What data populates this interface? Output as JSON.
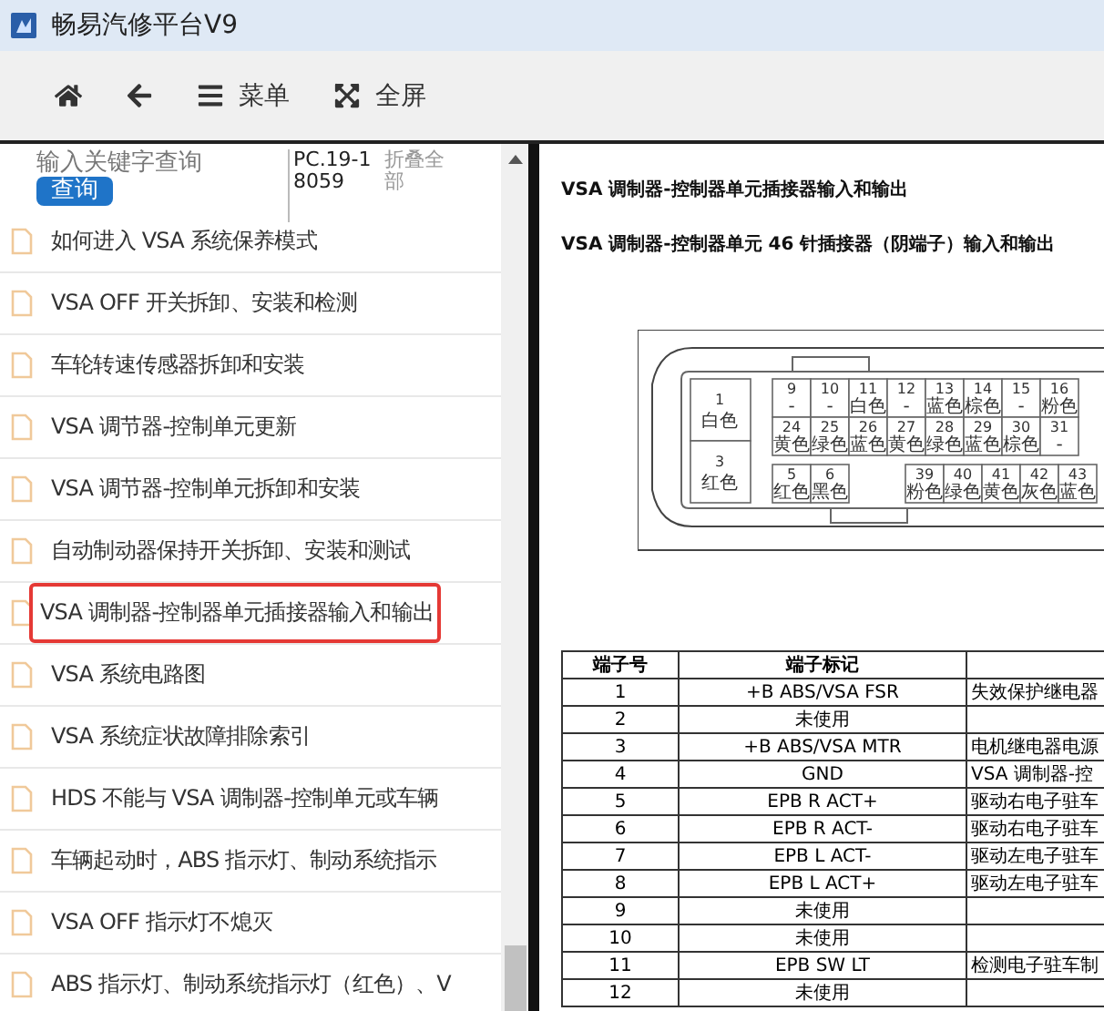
{
  "window": {
    "title": "畅易汽修平台V9"
  },
  "toolbar": [
    {
      "kind": "home"
    },
    {
      "kind": "back"
    },
    {
      "kind": "menu",
      "label": "菜单"
    },
    {
      "kind": "fullscreen",
      "label": "全屏"
    }
  ],
  "search": {
    "placeholder": "输入关键字查询",
    "button": "查询",
    "code": "PC.19-18059",
    "collapse": "折叠全部"
  },
  "topics": [
    {
      "title": "如何进入 VSA 系统保养模式",
      "selected": false
    },
    {
      "title": "VSA OFF 开关拆卸、安装和检测",
      "selected": false
    },
    {
      "title": "车轮转速传感器拆卸和安装",
      "selected": false
    },
    {
      "title": "VSA 调节器-控制单元更新",
      "selected": false
    },
    {
      "title": "VSA 调节器-控制单元拆卸和安装",
      "selected": false
    },
    {
      "title": "自动制动器保持开关拆卸、安装和测试",
      "selected": false
    },
    {
      "title": "VSA 调制器-控制器单元插接器输入和输出",
      "selected": true
    },
    {
      "title": "VSA 系统电路图",
      "selected": false
    },
    {
      "title": "VSA 系统症状故障排除索引",
      "selected": false
    },
    {
      "title": "HDS 不能与 VSA 调制器-控制单元或车辆",
      "selected": false
    },
    {
      "title": "车辆起动时，ABS 指示灯、制动系统指示",
      "selected": false
    },
    {
      "title": "VSA OFF 指示灯不熄灭",
      "selected": false
    },
    {
      "title": "ABS 指示灯、制动系统指示灯（红色）、V",
      "selected": false
    }
  ],
  "document": {
    "heading": "VSA 调制器-控制器单元插接器输入和输出",
    "subheading": "VSA 调制器-控制器单元 46 针插接器（阴端子）输入和输出",
    "connector": {
      "big_pins": [
        {
          "number": "1",
          "wire": "白色"
        },
        {
          "number": "3",
          "wire": "红色"
        }
      ],
      "upper_row": [
        {
          "number": "9",
          "wire": "-"
        },
        {
          "number": "10",
          "wire": "-"
        },
        {
          "number": "11",
          "wire": "白色"
        },
        {
          "number": "12",
          "wire": "-"
        },
        {
          "number": "13",
          "wire": "蓝色"
        },
        {
          "number": "14",
          "wire": "棕色"
        },
        {
          "number": "15",
          "wire": "-"
        },
        {
          "number": "16",
          "wire": "粉色"
        }
      ],
      "middle_row": [
        {
          "number": "24",
          "wire": "黄色"
        },
        {
          "number": "25",
          "wire": "绿色"
        },
        {
          "number": "26",
          "wire": "蓝色"
        },
        {
          "number": "27",
          "wire": "黄色"
        },
        {
          "number": "28",
          "wire": "绿色"
        },
        {
          "number": "29",
          "wire": "蓝色"
        },
        {
          "number": "30",
          "wire": "棕色"
        },
        {
          "number": "31",
          "wire": "-"
        }
      ],
      "lower_left": [
        {
          "number": "5",
          "wire": "红色"
        },
        {
          "number": "6",
          "wire": "黑色"
        }
      ],
      "lower_right": [
        {
          "number": "39",
          "wire": "粉色"
        },
        {
          "number": "40",
          "wire": "绿色"
        },
        {
          "number": "41",
          "wire": "黄色"
        },
        {
          "number": "42",
          "wire": "灰色"
        },
        {
          "number": "43",
          "wire": "蓝色"
        }
      ]
    },
    "table": {
      "columns": [
        "端子号",
        "端子标记"
      ],
      "rows": [
        [
          "1",
          "+B ABS/VSA FSR",
          "失效保护继电器"
        ],
        [
          "2",
          "未使用",
          ""
        ],
        [
          "3",
          "+B ABS/VSA MTR",
          "电机继电器电源"
        ],
        [
          "4",
          "GND",
          "VSA 调制器-控"
        ],
        [
          "5",
          "EPB R ACT+",
          "驱动右电子驻车"
        ],
        [
          "6",
          "EPB R ACT-",
          "驱动右电子驻车"
        ],
        [
          "7",
          "EPB L ACT-",
          "驱动左电子驻车"
        ],
        [
          "8",
          "EPB L ACT+",
          "驱动左电子驻车"
        ],
        [
          "9",
          "未使用",
          ""
        ],
        [
          "10",
          "未使用",
          ""
        ],
        [
          "11",
          "EPB SW LT",
          "检测电子驻车制"
        ],
        [
          "12",
          "未使用",
          ""
        ]
      ]
    }
  }
}
